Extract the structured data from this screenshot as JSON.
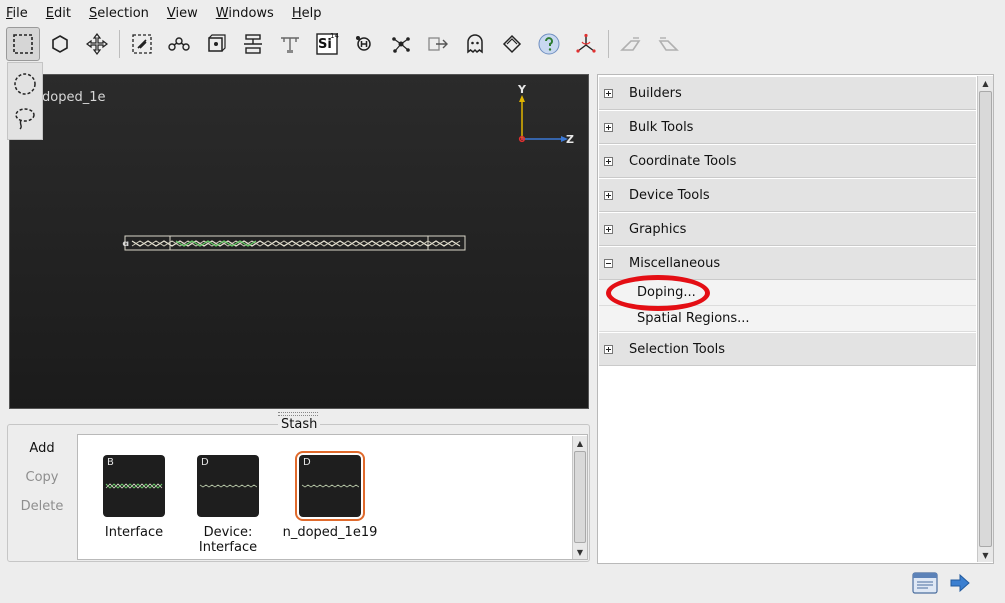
{
  "menu": {
    "items": [
      {
        "mnemonic": "F",
        "rest": "ile"
      },
      {
        "mnemonic": "E",
        "rest": "dit"
      },
      {
        "mnemonic": "S",
        "rest": "election"
      },
      {
        "mnemonic": "V",
        "rest": "iew"
      },
      {
        "mnemonic": "W",
        "rest": "indows"
      },
      {
        "mnemonic": "H",
        "rest": "elp"
      }
    ]
  },
  "toolbar": {
    "si_symbol": "Si",
    "si_number": "14"
  },
  "viewport": {
    "configuration_label": "doped_1e",
    "axis_y": "Y",
    "axis_z": "Z",
    "colors": {
      "y_axis": "#e0b400",
      "z_axis": "#3a78d6",
      "x_axis": "#e03030"
    }
  },
  "stash": {
    "title": "Stash",
    "actions": {
      "add": "Add",
      "copy": "Copy",
      "delete": "Delete"
    },
    "items": [
      {
        "tag": "B",
        "name": "Interface"
      },
      {
        "tag": "D",
        "name": "Device:\nInterface"
      },
      {
        "tag": "D",
        "name": "n_doped_1e19"
      }
    ]
  },
  "tools_panel": {
    "sections": {
      "builders": "Builders",
      "bulk_tools": "Bulk Tools",
      "coordinate_tools": "Coordinate Tools",
      "device_tools": "Device Tools",
      "graphics": "Graphics",
      "miscellaneous": "Miscellaneous",
      "selection_tools": "Selection Tools"
    },
    "misc_items": {
      "doping": "Doping...",
      "spatial_regions": "Spatial Regions..."
    },
    "highlight_color": "#e40e14"
  }
}
